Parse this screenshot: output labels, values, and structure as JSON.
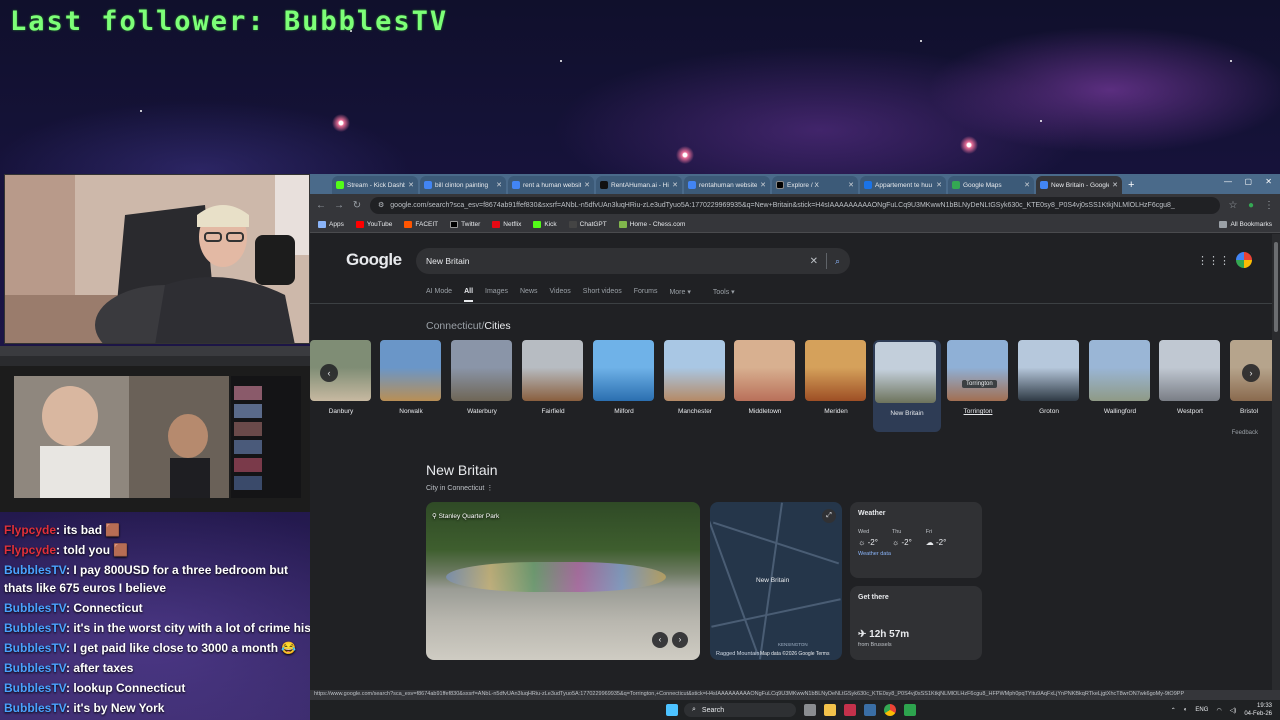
{
  "overlay": {
    "last_follower": "Last follower: BubblesTV"
  },
  "chat": {
    "messages": [
      {
        "user": "Flypcyde",
        "text": ": its bad",
        "color": "red"
      },
      {
        "user": "Flypcyde",
        "text": ": told you",
        "color": "red"
      },
      {
        "user": "BubblesTV",
        "text": ": I pay 800USD for a three bedroom but thats like 675 euros I believe",
        "color": "blue"
      },
      {
        "user": "BubblesTV",
        "text": ": Connecticut",
        "color": "blue"
      },
      {
        "user": "BubblesTV",
        "text": ": it's in the worst city with a lot of crime history",
        "color": "blue"
      },
      {
        "user": "BubblesTV",
        "text": ": I get paid like close to 3000 a month 😂",
        "color": "blue"
      },
      {
        "user": "BubblesTV",
        "text": ": after taxes",
        "color": "blue"
      },
      {
        "user": "BubblesTV",
        "text": ": lookup Connecticut",
        "color": "blue"
      },
      {
        "user": "BubblesTV",
        "text": ": it's by New York",
        "color": "blue"
      }
    ]
  },
  "browser": {
    "tabs": [
      {
        "label": "Stream - Kick Dashbo",
        "color": "#53fc18"
      },
      {
        "label": "bill clinton painting",
        "color": "#4285f4"
      },
      {
        "label": "rent a human websit",
        "color": "#4285f4"
      },
      {
        "label": "RentAHuman.ai - Hir",
        "color": "#111111"
      },
      {
        "label": "rentahuman website",
        "color": "#4285f4"
      },
      {
        "label": "Explore / X",
        "color": "#000000"
      },
      {
        "label": "Appartement te huu",
        "color": "#1a73e8"
      },
      {
        "label": "Google Maps",
        "color": "#34a853"
      },
      {
        "label": "New Britain - Google",
        "color": "#4285f4",
        "active": true
      }
    ],
    "url": "google.com/search?sca_esv=f8674ab91ffef830&sxsrf=ANbL-n5dfvUAn3luqHRiu-zLe3udTyuo5A:1770229969935&q=New+Britain&stick=H4sIAAAAAAAAAONgFuLCq9U3MKwwN1bBLNyDeNLtGSyk630c_KTE0sy8_P0S4vj0sSS1KtkjNLMlOLHzF6cgu8_",
    "bookmarks": [
      "Apps",
      "YouTube",
      "FACEIT",
      "Twitter",
      "Netflix",
      "Kick",
      "ChatGPT",
      "Home - Chess.com"
    ],
    "all_bookmarks": "All Bookmarks",
    "status_url": "https://www.google.com/search?sca_esv=f8674ab91ffef830&sxsrf=ANbL-n5dfvUAn3luqHRiu-zLe3udTyuo5A:1770229969935&q=Torrington,+Connecticut&stick=H4sIAAAAAAAAAONgFuLCq9U3MKwwN1bBLNyDeNLtGSyk630c_KTE0sy8_P0S4vj0sSS1KtkjNLMlOLHzF6cgu8_HFPWMph0pqTYitu9AqFxLjYnPNKBkqRTkeLjgtXhcT8wrON7wk6goMy-9tO9PP"
  },
  "google": {
    "logo": "Google",
    "query": "New Britain",
    "tabs": [
      "AI Mode",
      "All",
      "Images",
      "News",
      "Videos",
      "Short videos",
      "Forums",
      "More",
      "Tools"
    ],
    "active_tab": "All",
    "breadcrumb_parent": "Connecticut",
    "breadcrumb_sep": "/",
    "breadcrumb_current": "Cities",
    "cities": [
      {
        "name": "Danbury",
        "c1": "#7f8d75",
        "c2": "#c7b9a1"
      },
      {
        "name": "Norwalk",
        "c1": "#6a96c8",
        "c2": "#b98f55"
      },
      {
        "name": "Waterbury",
        "c1": "#8a95a8",
        "c2": "#6f6656"
      },
      {
        "name": "Fairfield",
        "c1": "#b7bcc2",
        "c2": "#8a5f3e"
      },
      {
        "name": "Milford",
        "c1": "#6fb2e8",
        "c2": "#2b6fb0"
      },
      {
        "name": "Manchester",
        "c1": "#a9c7e4",
        "c2": "#b58a66"
      },
      {
        "name": "Middletown",
        "c1": "#d8b090",
        "c2": "#b9705a"
      },
      {
        "name": "Meriden",
        "c1": "#d5a15b",
        "c2": "#9e4f25"
      },
      {
        "name": "New Britain",
        "c1": "#c3cfdb",
        "c2": "#6d735c"
      },
      {
        "name": "Torrington",
        "c1": "#8fb0d6",
        "c2": "#a26f52"
      },
      {
        "name": "Groton",
        "c1": "#b6c8dc",
        "c2": "#2f3a45"
      },
      {
        "name": "Wallingford",
        "c1": "#9ab6d6",
        "c2": "#8f9a86"
      },
      {
        "name": "Westport",
        "c1": "#c0c8d2",
        "c2": "#7a7e86"
      },
      {
        "name": "Bristol",
        "c1": "#b6a48c",
        "c2": "#8a6a4e"
      }
    ],
    "tooltip": "Torrington",
    "feedback": "Feedback",
    "kp": {
      "title": "New Britain",
      "subtitle": "City in Connecticut",
      "photo_caption": "Stanley Quarter Park",
      "map_label": "New Britain",
      "map_attr": "Map data ©2026 Google   Terms",
      "map_place": "KENSINGTON",
      "map_ragged": "Ragged Mountain",
      "weather": {
        "title": "Weather",
        "days": [
          {
            "day": "Wed",
            "temp": "-2°",
            "icon": "sun-icon"
          },
          {
            "day": "Thu",
            "temp": "-2°",
            "icon": "sun-icon"
          },
          {
            "day": "Fri",
            "temp": "-2°",
            "icon": "cloud-icon"
          }
        ],
        "source": "Weather data"
      },
      "get_there": {
        "title": "Get there",
        "duration": "12h 57m",
        "from": "from Brussels"
      }
    }
  },
  "taskbar": {
    "search": "Search",
    "lang": "ENG",
    "time": "19:33",
    "date": "04-Feb-26"
  }
}
